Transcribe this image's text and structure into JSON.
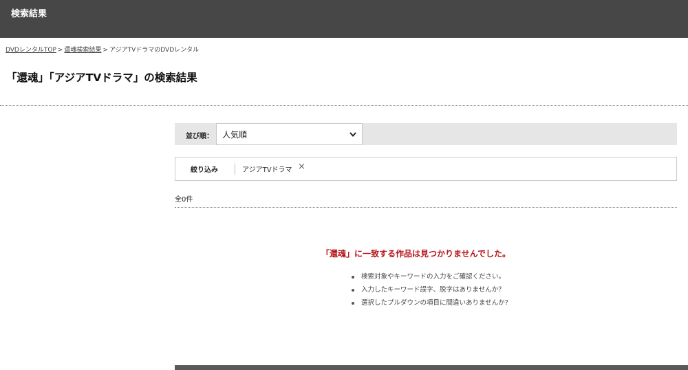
{
  "header": {
    "title": "検索結果"
  },
  "breadcrumb": {
    "items": [
      {
        "label": "DVDレンタルTOP",
        "link": true
      },
      {
        "label": "還魂検索結果",
        "link": true
      },
      {
        "label": "アジアTVドラマのDVDレンタル",
        "link": false
      }
    ],
    "separator": ">"
  },
  "page_title": "「還魂」「アジアTVドラマ」の検索結果",
  "sort": {
    "label": "並び順：",
    "selected": "人気順"
  },
  "filter": {
    "label": "絞り込み",
    "tag": "アジアTVドラマ",
    "remove_symbol": "×"
  },
  "result_count": "全0件",
  "no_result": {
    "message": "「還魂」に一致する作品は見つかりませんでした。",
    "hints": [
      "検索対象やキーワードの入力をご確認ください。",
      "入力したキーワード誤字、脱字はありませんか？",
      "選択したプルダウンの項目に間違いありませんか?"
    ]
  },
  "colors": {
    "header_bg": "#474747",
    "accent_red": "#b5141a",
    "sort_bar_bg": "#e6e6e6"
  }
}
